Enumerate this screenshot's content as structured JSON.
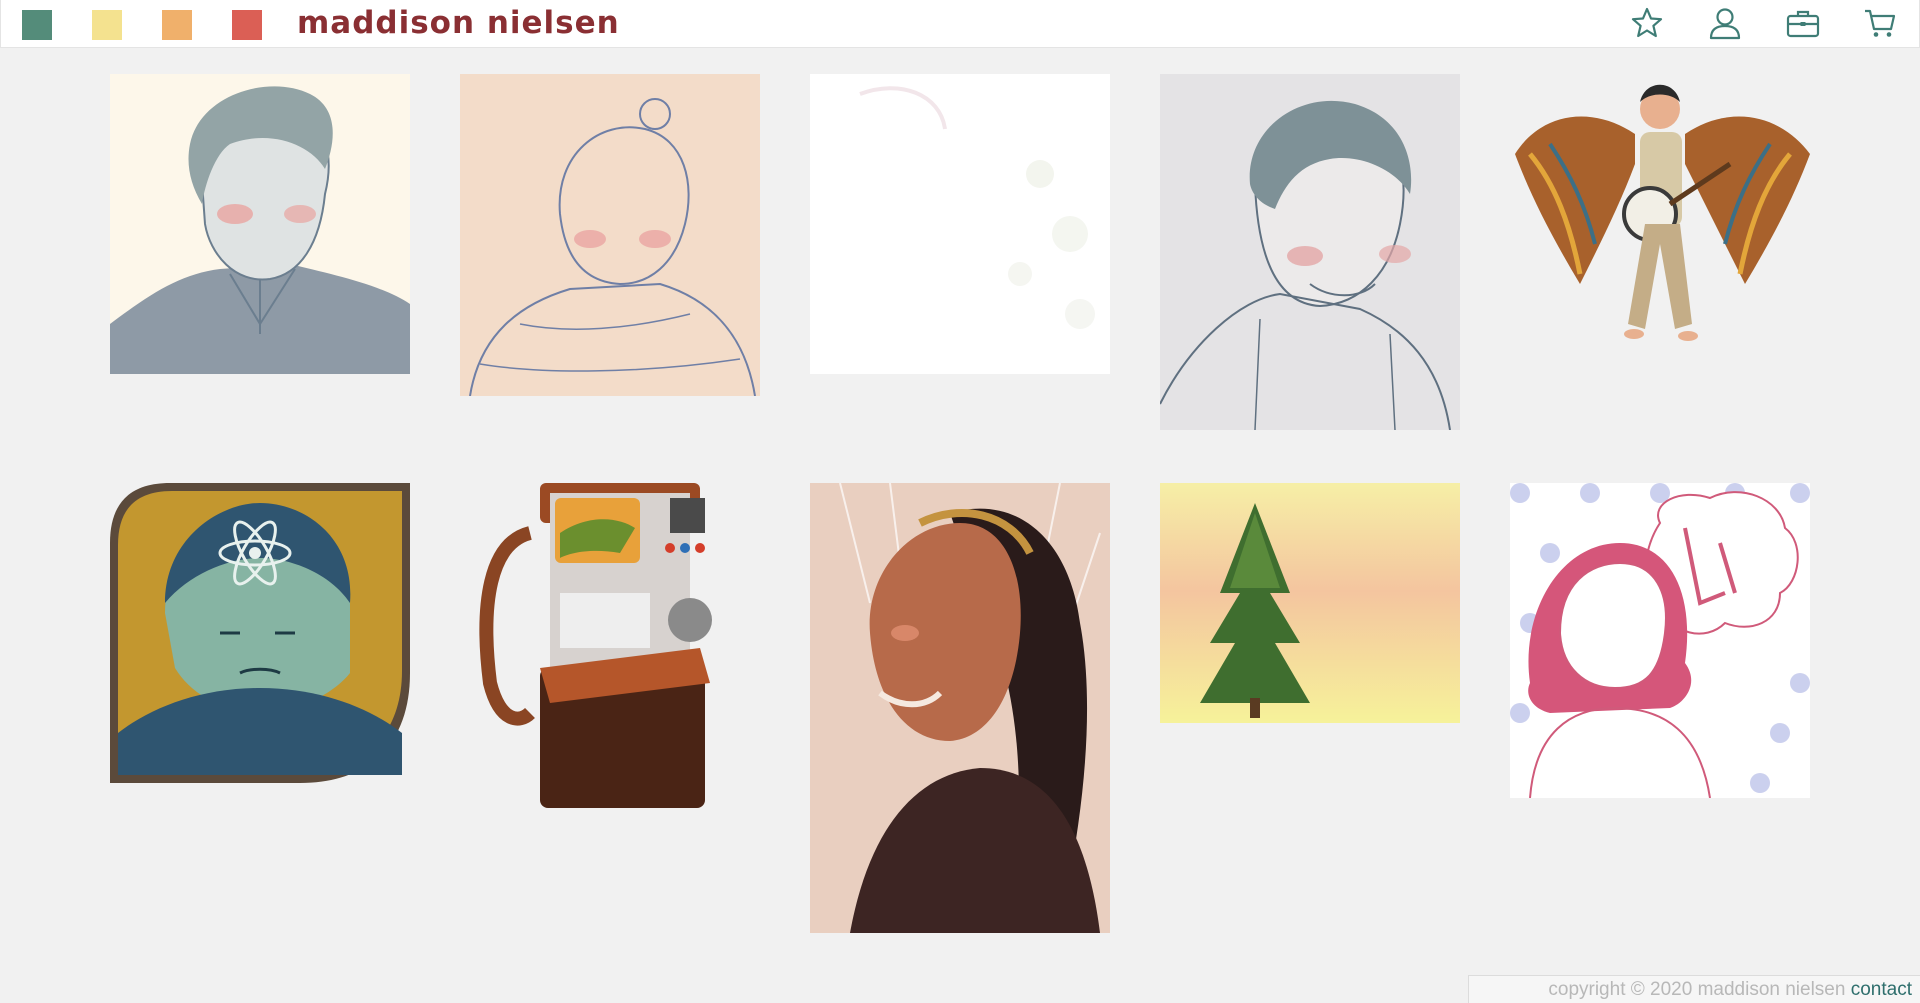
{
  "header": {
    "brand": "maddison nielsen",
    "swatches": [
      {
        "name": "teal",
        "color": "#548c7a"
      },
      {
        "name": "yellow",
        "color": "#f4e28f"
      },
      {
        "name": "orange",
        "color": "#f0b06b"
      },
      {
        "name": "red",
        "color": "#db5f55"
      }
    ],
    "nav_icons": [
      "star-icon",
      "user-icon",
      "briefcase-icon",
      "cart-icon"
    ],
    "icon_color": "#3f7d76"
  },
  "gallery": {
    "items": [
      {
        "name": "artwork-sketch-portrait-boy"
      },
      {
        "name": "artwork-sketch-portrait-girl-bun"
      },
      {
        "name": "artwork-faded-sketch"
      },
      {
        "name": "artwork-sketch-portrait-laughing"
      },
      {
        "name": "artwork-winged-banjo-player"
      },
      {
        "name": "artwork-atom-portrait"
      },
      {
        "name": "artwork-tricorder-bag"
      },
      {
        "name": "artwork-portrait-braids"
      },
      {
        "name": "artwork-pine-tree"
      },
      {
        "name": "artwork-la-girl"
      }
    ]
  },
  "footer": {
    "copyright": "copyright © 2020 maddison nielsen",
    "contact_label": "contact"
  }
}
